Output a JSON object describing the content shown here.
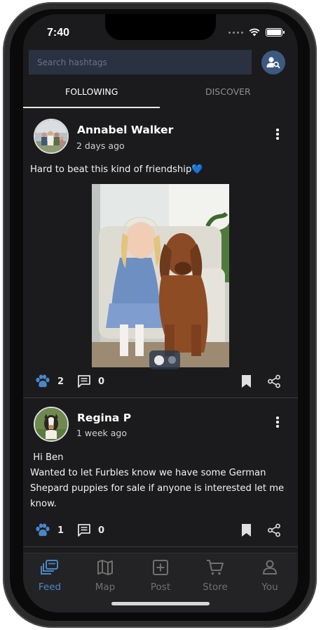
{
  "status": {
    "time": "7:40"
  },
  "search": {
    "placeholder": "Search hashtags"
  },
  "tabs": [
    {
      "label": "FOLLOWING",
      "active": true
    },
    {
      "label": "DISCOVER",
      "active": false
    }
  ],
  "posts": [
    {
      "author": "Annabel Walker",
      "time": "2 days ago",
      "text": "Hard to beat this kind of friendship💙",
      "paws": "2",
      "comments": "0",
      "image_pages": 2,
      "image_current": 1
    },
    {
      "author": "Regina P",
      "time": "1 week ago",
      "text_lines": [
        " Hi Ben",
        "Wanted to let Furbles know we have some German",
        "Shepard puppies for sale if anyone is interested let me",
        "know."
      ],
      "paws": "1",
      "comments": "0"
    }
  ],
  "nav": [
    {
      "label": "Feed",
      "icon": "feed-icon",
      "active": true
    },
    {
      "label": "Map",
      "icon": "map-icon",
      "active": false
    },
    {
      "label": "Post",
      "icon": "post-icon",
      "active": false
    },
    {
      "label": "Store",
      "icon": "cart-icon",
      "active": false
    },
    {
      "label": "You",
      "icon": "profile-icon",
      "active": false
    }
  ],
  "colors": {
    "accent": "#4a87c9",
    "background": "#1b1b1d",
    "search_bg": "#2a3141",
    "paw": "#4a87c9"
  }
}
